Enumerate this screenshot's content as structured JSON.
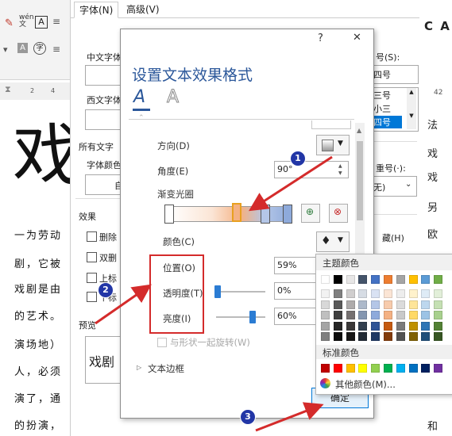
{
  "word": {
    "ruler_marks": [
      "2",
      "4"
    ],
    "big_char": "戏",
    "doc_lines": [
      "一为劳动",
      "剧，它被",
      "戏剧是由",
      "的艺术。",
      "演场地）",
      "人，必须",
      "演了，通",
      "的扮演，"
    ]
  },
  "font_dialog": {
    "tabs": [
      "字体(N)",
      "高级(V)"
    ],
    "chinese_font_label": "中文字体",
    "western_font_label": "西文字体",
    "all_text_label": "所有文字",
    "font_color_label": "字体颜色",
    "auto_text": "自",
    "effects_label": "效果",
    "checkboxes": [
      "删除",
      "双删",
      "上标",
      "下标"
    ],
    "preview_label": "预览",
    "preview_text": "戏剧",
    "size_label": "号(S):",
    "size_value": "四号",
    "size_list": [
      "三号",
      "小三",
      "四号"
    ],
    "emphasis_label": "重号(·):",
    "emphasis_value": "无)",
    "hidden_label": "藏(H)",
    "right_edge_chars": [
      "C A",
      "法",
      "戏",
      "另",
      "欧",
      "戏",
      "和"
    ],
    "right_ruler": "42"
  },
  "dialog": {
    "help": "?",
    "close": "✕",
    "title": "设置文本效果格式",
    "tab_fill_glyph": "A",
    "tab_outline_glyph": "A",
    "direction_label": "方向(D)",
    "angle_label": "角度(E)",
    "angle_value": "90°",
    "gradient_stops_label": "渐变光圈",
    "color_label": "颜色(C)",
    "position_label": "位置(O)",
    "position_value": "59%",
    "transparency_label": "透明度(T)",
    "transparency_value": "0%",
    "brightness_label": "亮度(I)",
    "brightness_value": "60%",
    "rotate_label": "与形状一起旋转(W)",
    "text_border_label": "文本边框",
    "ok_button": "确定"
  },
  "color_popup": {
    "theme_colors_label": "主题颜色",
    "standard_colors_label": "标准颜色",
    "more_colors_label": "其他颜色(M)...",
    "theme_top_row": [
      "#ffffff",
      "#000000",
      "#e7e6e6",
      "#44546a",
      "#4472c4",
      "#ed7d31",
      "#a5a5a5",
      "#ffc000",
      "#5b9bd5",
      "#70ad47"
    ],
    "theme_shades": [
      [
        "#f2f2f2",
        "#7f7f7f",
        "#d0cece",
        "#d6dce4",
        "#d9e2f3",
        "#fbe5d5",
        "#ededed",
        "#fff2cc",
        "#deebf6",
        "#e2efd9"
      ],
      [
        "#d8d8d8",
        "#595959",
        "#aeabab",
        "#adb9ca",
        "#b4c6e7",
        "#f7cbac",
        "#dbdbdb",
        "#fee599",
        "#bdd7ee",
        "#c5e0b3"
      ],
      [
        "#bfbfbf",
        "#3f3f3f",
        "#757070",
        "#8496b0",
        "#8eaadb",
        "#f4b183",
        "#c9c9c9",
        "#ffd965",
        "#9cc3e5",
        "#a8d08d"
      ],
      [
        "#a5a5a5",
        "#262626",
        "#3a3838",
        "#323f4f",
        "#2f5496",
        "#c55a11",
        "#7b7b7b",
        "#bf9000",
        "#2e75b5",
        "#538135"
      ],
      [
        "#7f7f7f",
        "#0c0c0c",
        "#171616",
        "#222a35",
        "#1e3864",
        "#833c0b",
        "#525252",
        "#7f6000",
        "#1e4e79",
        "#375623"
      ]
    ],
    "standard": [
      "#c00000",
      "#ff0000",
      "#ffc000",
      "#ffff00",
      "#92d050",
      "#00b050",
      "#00b0f0",
      "#0070c0",
      "#002060",
      "#7030a0"
    ]
  },
  "annotations": {
    "badge_1": "1",
    "badge_2": "2",
    "badge_3": "3",
    "arrow_color": "#d42b2b",
    "badge_color": "#2236a6"
  }
}
